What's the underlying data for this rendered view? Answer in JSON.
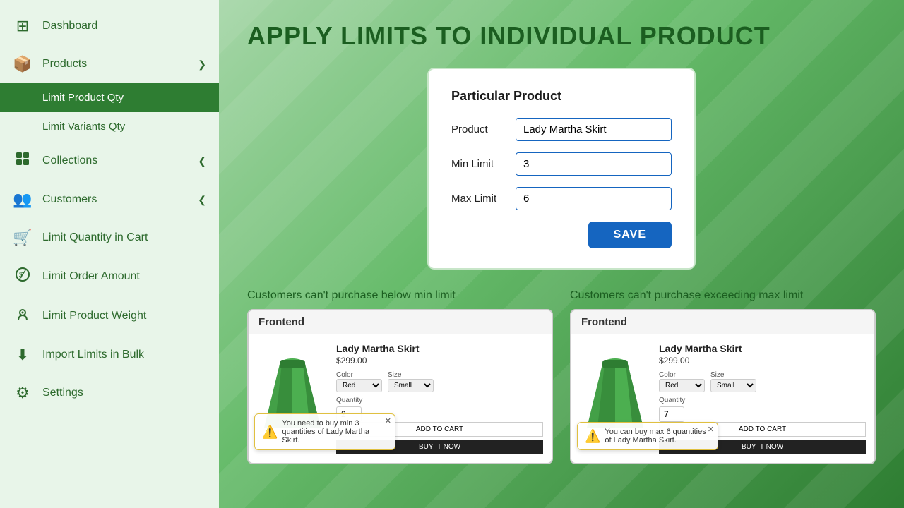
{
  "sidebar": {
    "items": [
      {
        "id": "dashboard",
        "label": "Dashboard",
        "icon": "⊞",
        "active": false,
        "sub": []
      },
      {
        "id": "products",
        "label": "Products",
        "icon": "📦",
        "active": true,
        "chevron": "❯",
        "sub": [
          {
            "id": "limit-product-qty",
            "label": "Limit Product Qty",
            "active": true
          },
          {
            "id": "limit-variants-qty",
            "label": "Limit Variants Qty",
            "active": false
          }
        ]
      },
      {
        "id": "collections",
        "label": "Collections",
        "icon": "⊟",
        "active": false,
        "chevron": "❮",
        "sub": []
      },
      {
        "id": "customers",
        "label": "Customers",
        "icon": "👥",
        "active": false,
        "chevron": "❮",
        "sub": []
      },
      {
        "id": "limit-quantity-cart",
        "label": "Limit Quantity in Cart",
        "icon": "🛒",
        "active": false,
        "sub": []
      },
      {
        "id": "limit-order-amount",
        "label": "Limit Order Amount",
        "icon": "💰",
        "active": false,
        "sub": []
      },
      {
        "id": "limit-product-weight",
        "label": "Limit Product Weight",
        "icon": "⚙",
        "active": false,
        "sub": []
      },
      {
        "id": "import-limits",
        "label": "Import Limits in Bulk",
        "icon": "⬇",
        "active": false,
        "sub": []
      },
      {
        "id": "settings",
        "label": "Settings",
        "icon": "⚙",
        "active": false,
        "sub": []
      }
    ]
  },
  "main": {
    "title": "APPLY LIMITS TO INDIVIDUAL PRODUCT",
    "card": {
      "title": "Particular Product",
      "fields": [
        {
          "id": "product",
          "label": "Product",
          "value": "Lady Martha Skirt"
        },
        {
          "id": "min-limit",
          "label": "Min Limit",
          "value": "3"
        },
        {
          "id": "max-limit",
          "label": "Max Limit",
          "value": "6"
        }
      ],
      "save_button": "SAVE"
    },
    "previews": [
      {
        "id": "min-preview",
        "caption": "Customers can't purchase below min limit",
        "header": "Frontend",
        "product_name": "Lady Martha Skirt",
        "price": "$299.00",
        "color_label": "Color",
        "color_value": "Red",
        "size_label": "Size",
        "size_value": "Small",
        "qty_label": "Quantity",
        "qty_value": "2",
        "add_cart": "ADD TO CART",
        "buy_now": "BUY IT NOW",
        "tooltip": "You need to buy min 3 quantities of Lady Martha Skirt."
      },
      {
        "id": "max-preview",
        "caption": "Customers can't purchase exceeding max limit",
        "header": "Frontend",
        "product_name": "Lady Martha Skirt",
        "price": "$299.00",
        "color_label": "Color",
        "color_value": "Red",
        "size_label": "Size",
        "size_value": "Small",
        "qty_label": "Quantity",
        "qty_value": "7",
        "add_cart": "ADD TO CART",
        "buy_now": "BUY IT NOW",
        "tooltip": "You can buy max 6 quantities of Lady Martha Skirt."
      }
    ]
  }
}
